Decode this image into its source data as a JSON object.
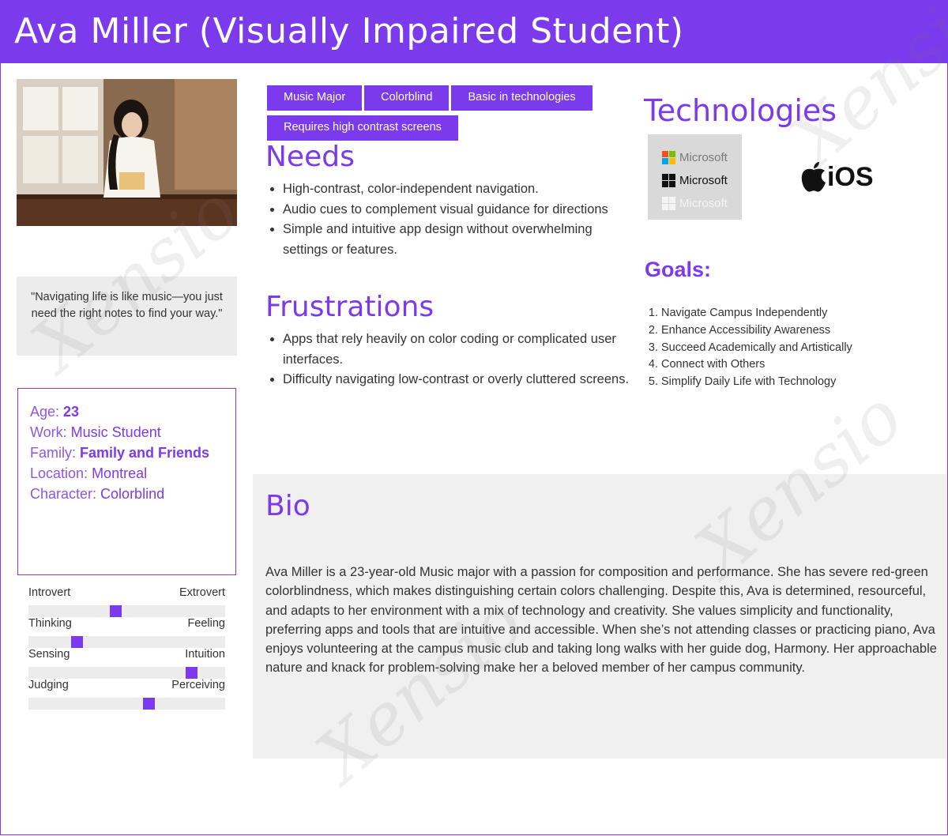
{
  "header": {
    "title": "Ava Miller (Visually Impaired Student)"
  },
  "colors": {
    "accent": "#7c3aed",
    "panel": "#ececec"
  },
  "profile": {
    "quote": "\"Navigating life is like music—you just need the right notes to find your way.\"",
    "facts": [
      {
        "label": "Age: ",
        "value": "23"
      },
      {
        "label": "Work: ",
        "value": "Music Student"
      },
      {
        "label": "Family: ",
        "value": "Family and Friends"
      },
      {
        "label": "Location: ",
        "value": "Montreal"
      },
      {
        "label": "Character: ",
        "value": "Colorblind"
      }
    ],
    "traits": [
      {
        "left": "Introvert",
        "right": "Extrovert",
        "level": 0.44
      },
      {
        "left": "Thinking",
        "right": "Feeling",
        "level": 0.23
      },
      {
        "left": "Sensing",
        "right": "Intuition",
        "level": 0.85
      },
      {
        "left": "Judging",
        "right": "Perceiving",
        "level": 0.62
      }
    ]
  },
  "tags": [
    "Music Major",
    "Colorblind",
    "Basic in technologies",
    "Requires high contrast screens"
  ],
  "needs": {
    "title": "Needs",
    "items": [
      "High-contrast, color-independent navigation.",
      "Audio cues to complement visual guidance for directions",
      "Simple and intuitive app design without overwhelming settings or features."
    ]
  },
  "frustrations": {
    "title": "Frustrations",
    "items": [
      "Apps that rely heavily on color coding or complicated user interfaces.",
      "Difficulty navigating low-contrast or overly cluttered screens."
    ]
  },
  "technologies": {
    "title": "Technologies",
    "microsoft": [
      "Microsoft",
      "Microsoft",
      "Microsoft"
    ],
    "ios": "iOS"
  },
  "goals": {
    "title": "Goals:",
    "items": [
      "Navigate Campus Independently",
      "Enhance Accessibility Awareness",
      "Succeed Academically and Artistically",
      "Connect with Others",
      "Simplify Daily Life with Technology"
    ]
  },
  "bio": {
    "title": "Bio",
    "text": "Ava Miller is a 23-year-old Music major with a passion for composition and performance. She has severe red-green colorblindness, which makes distinguishing certain colors challenging. Despite this, Ava is determined, resourceful, and adapts to her environment with a mix of technology and creativity. She values simplicity and functionality, preferring apps and tools that are intuitive and accessible. When she’s not attending classes or practicing piano, Ava enjoys volunteering at the campus music club and taking long walks with her guide dog, Harmony. Her approachable nature and knack for problem-solving make her a beloved member of her campus community."
  }
}
